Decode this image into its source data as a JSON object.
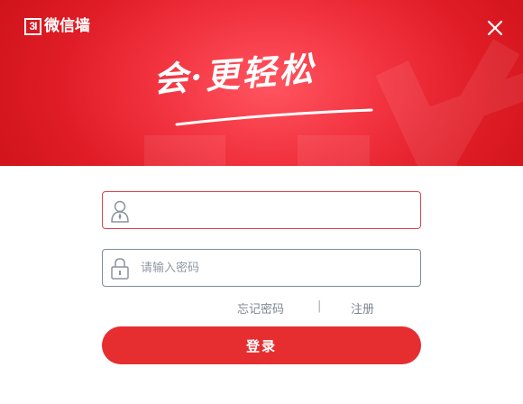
{
  "app": {
    "logo_mark": "3I",
    "logo_text": "微信墙"
  },
  "banner": {
    "slogan": "会·更轻松"
  },
  "form": {
    "username": {
      "value": "",
      "placeholder": ""
    },
    "password": {
      "value": "",
      "placeholder": "请输入密码"
    },
    "forgot_label": "忘记密码",
    "separator": "|",
    "register_label": "注册",
    "login_label": "登录"
  },
  "colors": {
    "brand_red": "#e01d27",
    "button_red": "#e62e30",
    "focus_border": "#e04048",
    "link_gray": "#7d8792"
  },
  "icons": [
    "close-icon",
    "user-icon",
    "lock-icon"
  ]
}
